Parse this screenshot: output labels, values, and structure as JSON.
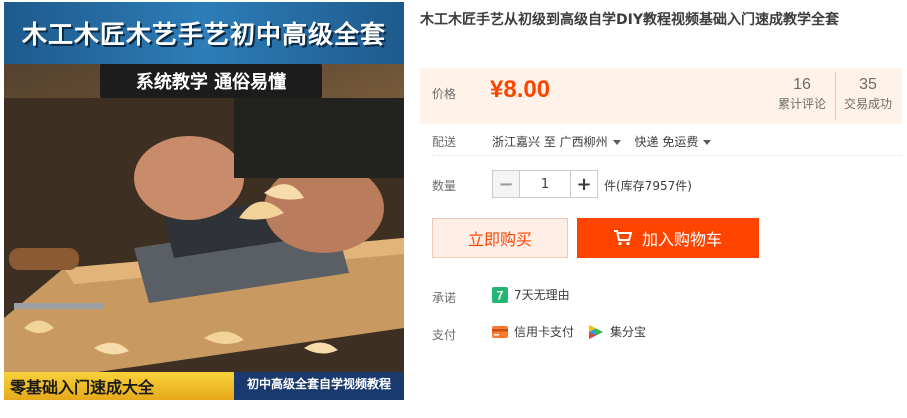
{
  "product": {
    "title": "木工木匠手艺从初级到高级自学DIY教程视频基础入门速成教学全套",
    "image": {
      "banner_text": "木工木匠木艺手艺初中高级全套",
      "subtitle_text": "系统教学 通俗易懂",
      "bottom_left_text": "零基础入门速成大全",
      "bottom_right_text": "初中高级全套自学视频教程"
    }
  },
  "price": {
    "label": "价格",
    "value": "¥8.00",
    "comments_count": "16",
    "comments_label": "累计评论",
    "trades_count": "35",
    "trades_label": "交易成功"
  },
  "delivery": {
    "label": "配送",
    "origin": "浙江嘉兴 至",
    "destination": "广西柳州",
    "shipping": "快递 免运费"
  },
  "quantity": {
    "label": "数量",
    "value": "1",
    "minus_symbol": "−",
    "plus_symbol": "+",
    "unit_text": "件(库存7957件)"
  },
  "actions": {
    "buy_now_label": "立即购买",
    "add_to_cart_label": "加入购物车"
  },
  "promise": {
    "label": "承诺",
    "item": "7天无理由"
  },
  "payment": {
    "label": "支付",
    "methods": [
      "信用卡支付",
      "集分宝"
    ]
  },
  "colors": {
    "accent": "#ff4400",
    "price_background": "#fff2e8",
    "buy_now_background": "#ffeee6"
  },
  "icons": {
    "cart": "shopping-cart-icon",
    "promise": "seven-day-return-icon",
    "credit_card": "credit-card-icon",
    "jifenbao": "jifenbao-icon"
  }
}
